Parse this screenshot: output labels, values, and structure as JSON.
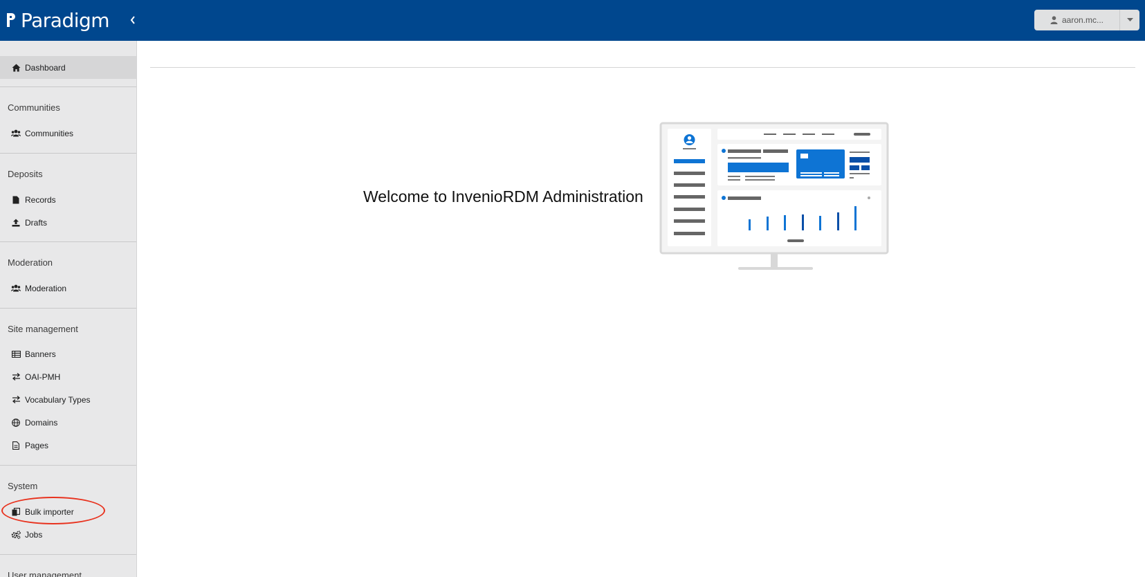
{
  "topbar": {
    "brand": "Paradigm",
    "user_label": "aaron.mc...",
    "colors": {
      "bar": "#00478e",
      "accent": "#0e74d4"
    },
    "icons": {
      "collapse": "chevron-left-icon",
      "user": "user-icon",
      "dropdown": "caret-down-icon"
    }
  },
  "sidebar": {
    "dashboard": {
      "label": "Dashboard",
      "icon": "home-icon"
    },
    "sections": {
      "communities": {
        "header": "Communities",
        "items": [
          {
            "label": "Communities",
            "icon": "users-icon"
          }
        ]
      },
      "deposits": {
        "header": "Deposits",
        "items": [
          {
            "label": "Records",
            "icon": "file-icon"
          },
          {
            "label": "Drafts",
            "icon": "upload-icon"
          }
        ]
      },
      "moderation": {
        "header": "Moderation",
        "items": [
          {
            "label": "Moderation",
            "icon": "users-icon"
          }
        ]
      },
      "site_management": {
        "header": "Site management",
        "items": [
          {
            "label": "Banners",
            "icon": "table-icon"
          },
          {
            "label": "OAI-PMH",
            "icon": "exchange-icon"
          },
          {
            "label": "Vocabulary Types",
            "icon": "exchange-icon"
          },
          {
            "label": "Domains",
            "icon": "globe-icon"
          },
          {
            "label": "Pages",
            "icon": "document-icon"
          }
        ]
      },
      "system": {
        "header": "System",
        "items": [
          {
            "label": "Bulk importer",
            "icon": "copy-icon"
          },
          {
            "label": "Jobs",
            "icon": "cogs-icon"
          }
        ]
      },
      "user_management": {
        "header": "User management"
      }
    }
  },
  "main": {
    "welcome": "Welcome to InvenioRDM Administration"
  }
}
